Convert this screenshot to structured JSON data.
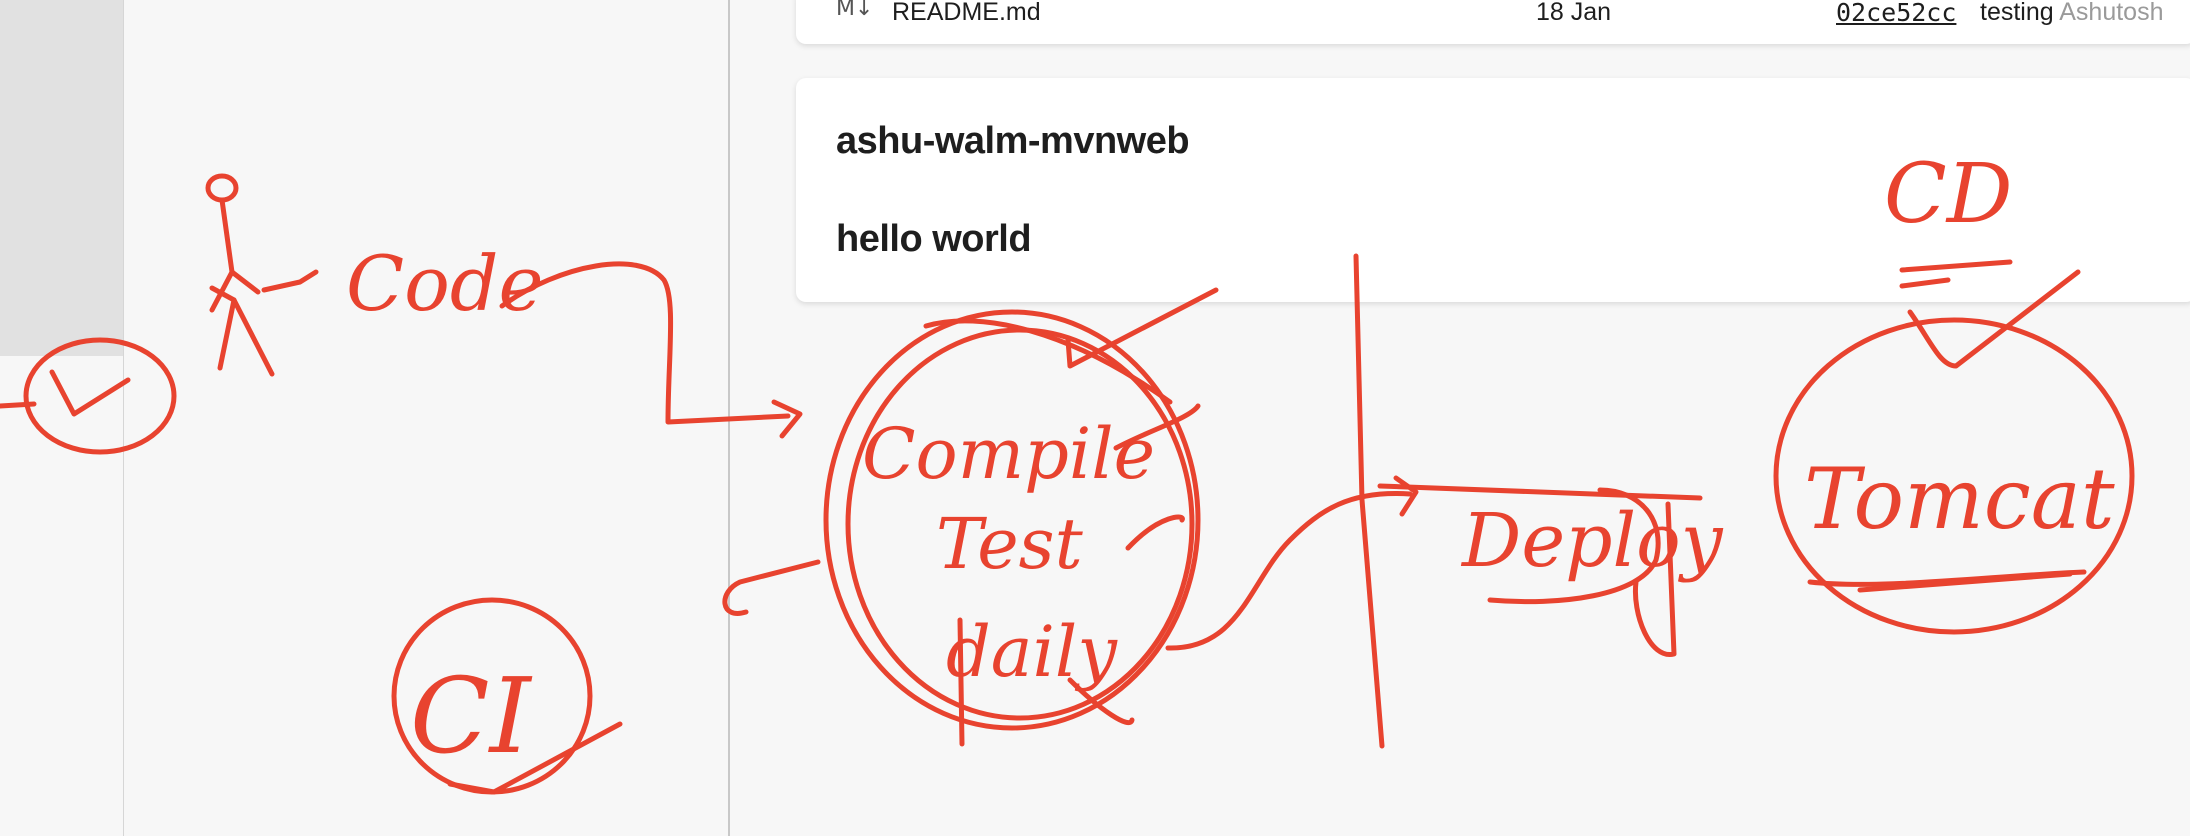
{
  "file_row": {
    "icon": "markdown-icon",
    "icon_glyph": "M↓",
    "name": "README.md",
    "date": "18 Jan",
    "commit": "02ce52cc",
    "message": "testing",
    "author": "Ashutosh"
  },
  "readme": {
    "title": "ashu-walm-mvnweb",
    "body": "hello world"
  },
  "annotations": {
    "code": "Code",
    "ci": "CI",
    "cd": "CD",
    "compile": "Compile",
    "test": "Test",
    "daily": "daily",
    "deploy": "Deploy",
    "tomcat": "Tomcat",
    "color": "#e8432f"
  }
}
